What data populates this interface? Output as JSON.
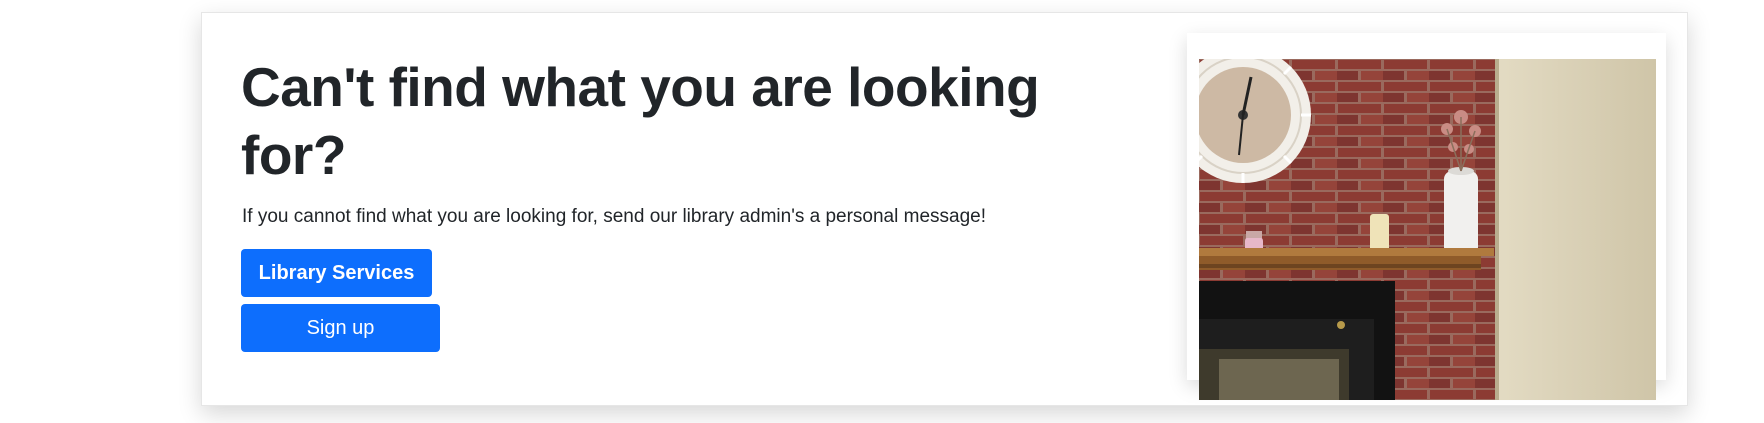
{
  "promo": {
    "heading": "Can't find what you are looking for?",
    "subtext": "If you cannot find what you are looking for, send our library admin's a personal message!",
    "buttons": {
      "library_services": "Library Services",
      "sign_up": "Sign up"
    }
  },
  "colors": {
    "primary_button": "#0d6efd",
    "heading_text": "#212529"
  },
  "image": {
    "subject": "fireplace-mantel-with-clock-photo"
  }
}
